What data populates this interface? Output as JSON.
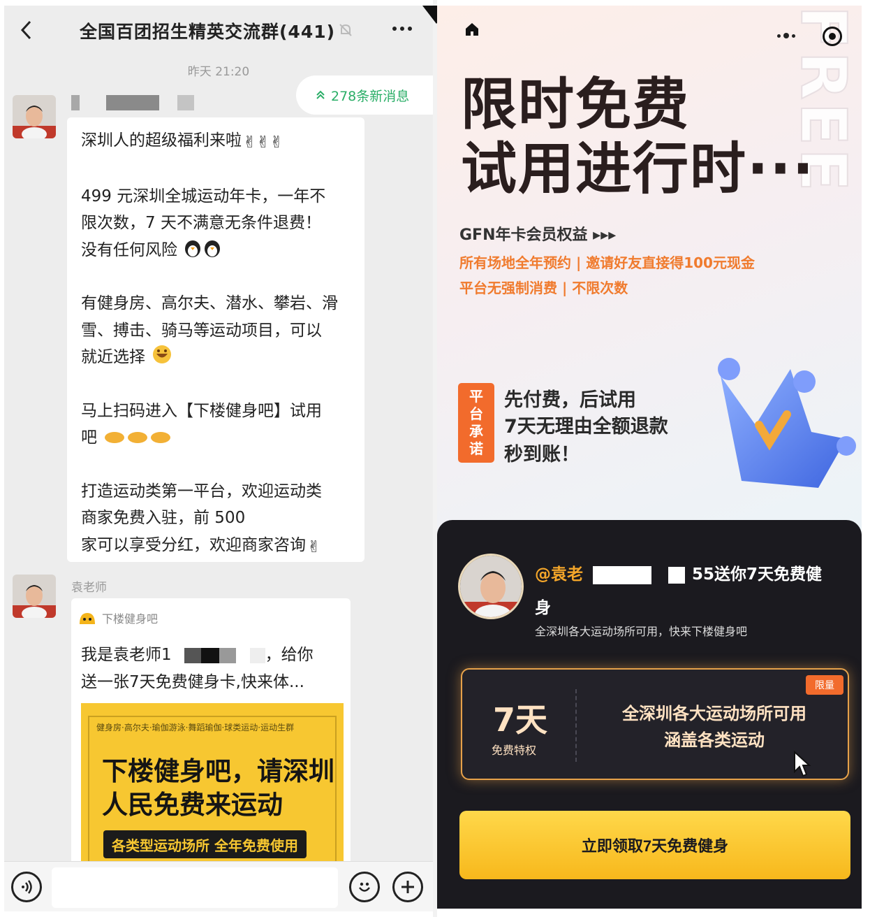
{
  "chat": {
    "title": "全国百团招生精英交流群(441)",
    "timestamp": "昨天 21:20",
    "new_messages": "278条新消息",
    "message1": {
      "paragraph1_line1": "深圳人的超级福利来啦",
      "paragraph2_line1": "499 元深圳全城运动年卡，一年不",
      "paragraph2_line2": "限次数，7 天不满意无条件退费！",
      "paragraph2_line3": "没有任何风险",
      "paragraph3_line1": "有健身房、高尔夫、潜水、攀岩、滑",
      "paragraph3_line2": "雪、搏击、骑马等运动项目，可以",
      "paragraph3_line3": "就近选择",
      "paragraph4_line1": "马上扫码进入【下楼健身吧】试用",
      "paragraph4_line2": "吧",
      "paragraph5_line1": "打造运动类第一平台，欢迎运动类",
      "paragraph5_line2": "商家免费入驻，前 500",
      "paragraph5_line3": "家可以享受分红，欢迎商家咨询"
    },
    "message2": {
      "sender": "袁老师",
      "source_name": "下楼健身吧",
      "desc_line1": "我是袁老师1",
      "desc_line1_end": "，给你",
      "desc_line2": "送一张7天免费健身卡,快来体...",
      "image_tags": "健身房·高尔夫·瑜伽游泳·舞蹈瑜伽·球类运动·运动生群",
      "image_title": "下楼健身吧，请深圳人民免费来运动",
      "image_sub": "各类型运动场所 全年免费使用"
    }
  },
  "promo": {
    "watermark": "FREE",
    "headline_line1": "限时免费",
    "headline_line2": "试用进行时···",
    "benefits_title": "GFN年卡会员权益 ▸▸▸",
    "benefit_line1": "所有场地全年预约 | 邀请好友直接得100元现金",
    "benefit_line2": "平台无强制消费 | 不限次数",
    "promise_badge": [
      "平",
      "台",
      "承",
      "诺"
    ],
    "promise_line1": "先付费，后试用",
    "promise_line2": "7天无理由全额退款",
    "promise_line3": "秒到账！",
    "invite_handle": "@袁老",
    "invite_tail": "55送你7天免费健",
    "invite_tail2": "身",
    "invite_sub": "全深圳各大运动场所可用，快来下楼健身吧",
    "coupon_tag": "限量",
    "coupon_days": "7天",
    "coupon_days_sub": "免费特权",
    "coupon_desc_line1": "全深圳各大运动场所可用",
    "coupon_desc_line2": "涵盖各类运动",
    "claim_button": "立即领取7天免费健身"
  },
  "colors": {
    "chat_bg": "#ededed",
    "wechat_green": "#2aae67",
    "promo_orange": "#f26b2c",
    "benefit_orange": "#f07b2e",
    "gold_button": "#f7b81c",
    "dark_panel": "#1b1a1f"
  },
  "icons": [
    "back-arrow-icon",
    "mute-bell-icon",
    "more-dots-icon",
    "double-chevron-up-icon",
    "victory-hand-emoji",
    "penguin-emoji",
    "grin-emoji",
    "flex-arm-emoji",
    "voice-icon",
    "emoji-face-icon",
    "plus-icon",
    "home-icon",
    "target-icon",
    "crown-icon",
    "cursor-icon"
  ]
}
